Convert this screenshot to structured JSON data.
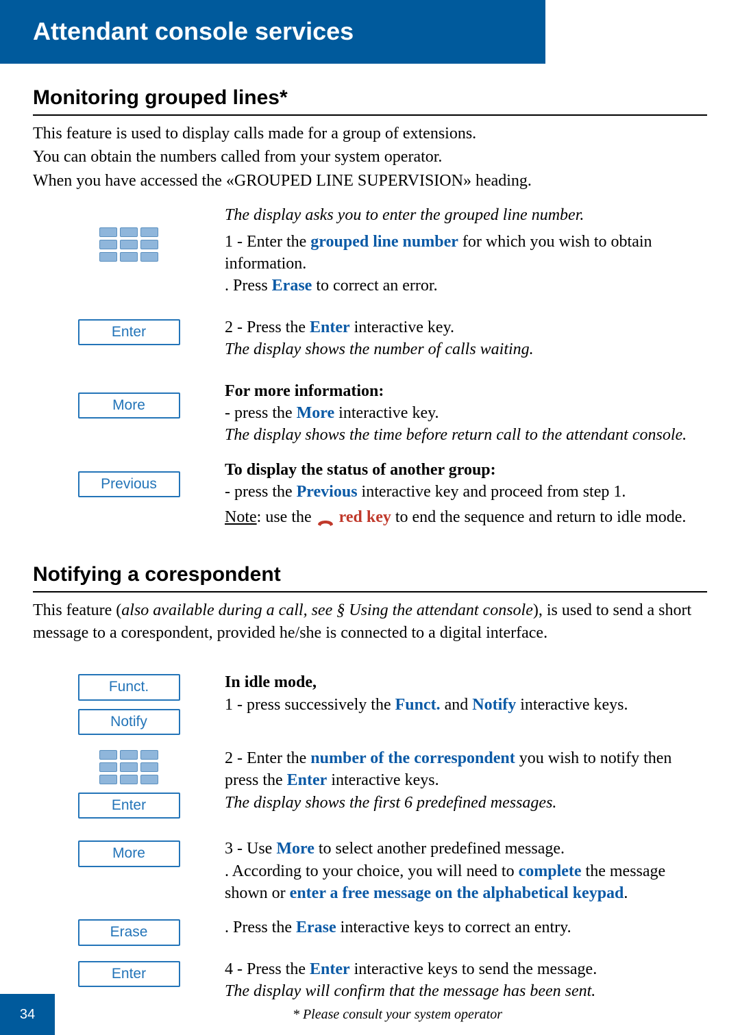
{
  "header": {
    "title": "Attendant console services"
  },
  "section1": {
    "title": "Monitoring grouped lines*",
    "intro1": "This feature is used to display calls made for a group of extensions.",
    "intro2": "You can obtain the numbers called from your system operator.",
    "intro3": "When you have accessed the «GROUPED LINE SUPERVISION» heading.",
    "prompt_italic": "The display asks you to enter the grouped line number.",
    "s1a": "1 - Enter the ",
    "s1_bold": "grouped line number",
    "s1b": " for which you wish to obtain information.",
    "s1c": ". Press ",
    "s1_erase": "Erase",
    "s1d": " to correct an error.",
    "s2a": "2 - Press the ",
    "s2_enter": "Enter",
    "s2b": " interactive key.",
    "s2_italic": "The display shows the number of calls waiting.",
    "more_hdr": "For more information:",
    "more_a": "- press the ",
    "more_key": "More",
    "more_b": " interactive key.",
    "more_italic": "The display shows the time before return call to the attendant console.",
    "prev_hdr": "To display the status of another group:",
    "prev_a": "- press the ",
    "prev_key": "Previous",
    "prev_b": " interactive key and proceed from step 1.",
    "note_a": "Note",
    "note_b": ": use the ",
    "note_red": "red key",
    "note_c": " to end the sequence and return to idle mode.",
    "buttons": {
      "enter": "Enter",
      "more": "More",
      "previous": "Previous"
    }
  },
  "section2": {
    "title": "Notifying a corespondent",
    "intro_a": "This feature (",
    "intro_italic": "also available during a call, see § Using the attendant console",
    "intro_b": "), is used to send a short message to a corespondent, provided he/she is connected to a digital interface.",
    "idle_hdr": "In idle mode,",
    "s1a": "1 - press successively the ",
    "s1_funct": "Funct.",
    "s1_and": " and ",
    "s1_notify": "Notify",
    "s1b": " interactive keys.",
    "s2a": "2 - Enter the ",
    "s2_bold": "number of the correspondent",
    "s2b": " you wish to notify then press the ",
    "s2_enter": "Enter",
    "s2c": " interactive keys.",
    "s2_italic": "The display shows the first 6 predefined messages.",
    "s3a": "3 - Use ",
    "s3_more": "More",
    "s3b": " to select another predefined message.",
    "s3c": ". According to your choice, you will need to ",
    "s3_complete": "complete",
    "s3d": " the message shown or ",
    "s3_free": "enter a free message on the alphabetical keypad",
    "s3e": ".",
    "s3f": ". Press the ",
    "s3_erase": "Erase",
    "s3g": " interactive keys to correct an entry.",
    "s4a": "4 - Press the ",
    "s4_enter": "Enter",
    "s4b": " interactive keys to send the message.",
    "s4_italic": "The display will confirm that the message has been sent.",
    "buttons": {
      "funct": "Funct.",
      "notify": "Notify",
      "enter": "Enter",
      "more": "More",
      "erase": "Erase"
    }
  },
  "footer": {
    "page": "34",
    "note": "* Please consult your system operator"
  }
}
